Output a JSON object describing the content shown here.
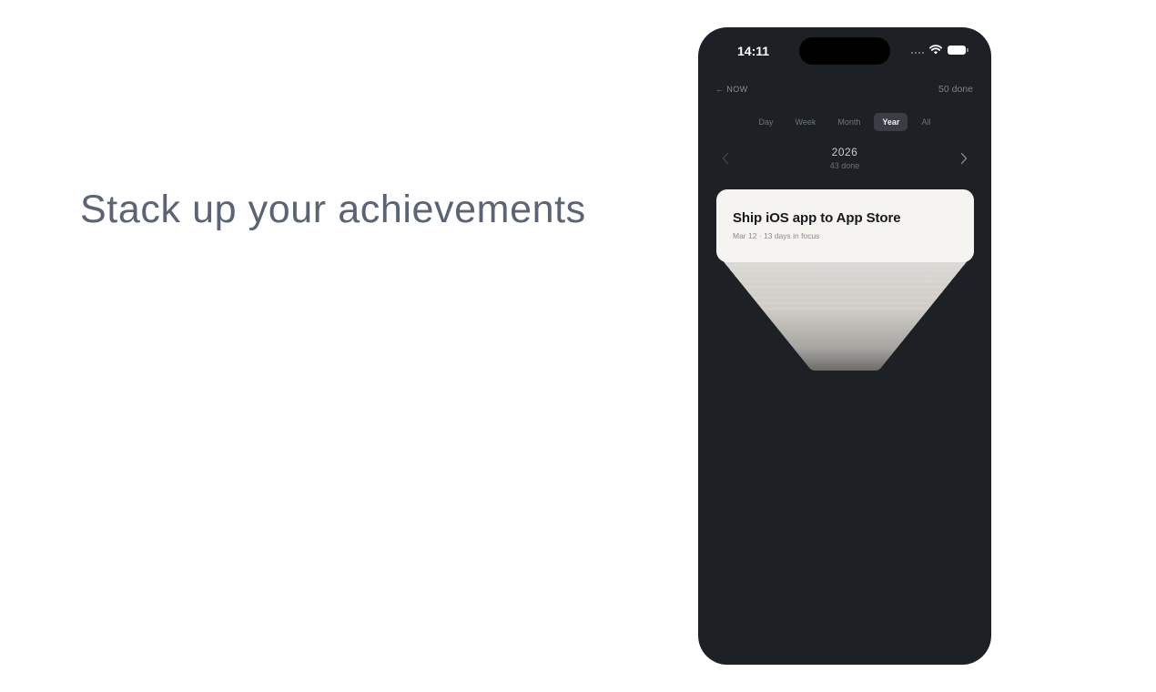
{
  "headline": "Stack up your achievements",
  "status_bar": {
    "time": "14:11",
    "icons": [
      "signal-dots-icon",
      "wifi-icon",
      "battery-icon"
    ]
  },
  "header": {
    "back_arrow": "←",
    "back_label": "NOW",
    "done_total": "50 done"
  },
  "tabs": [
    {
      "label": "Day",
      "active": false
    },
    {
      "label": "Week",
      "active": false
    },
    {
      "label": "Month",
      "active": false
    },
    {
      "label": "Year",
      "active": true
    },
    {
      "label": "All",
      "active": false
    }
  ],
  "period": {
    "label": "2026",
    "count": "43 done",
    "prev_icon": "chevron-left-icon",
    "next_icon": "chevron-right-icon"
  },
  "top_card": {
    "title": "Ship iOS app to App Store",
    "meta": "Mar 12 · 13 days in focus"
  },
  "colors": {
    "phone_background": "#1d2024",
    "card_background": "#f6f4f0",
    "active_tab": "#3a3e44",
    "headline_text": "#5a6474"
  }
}
